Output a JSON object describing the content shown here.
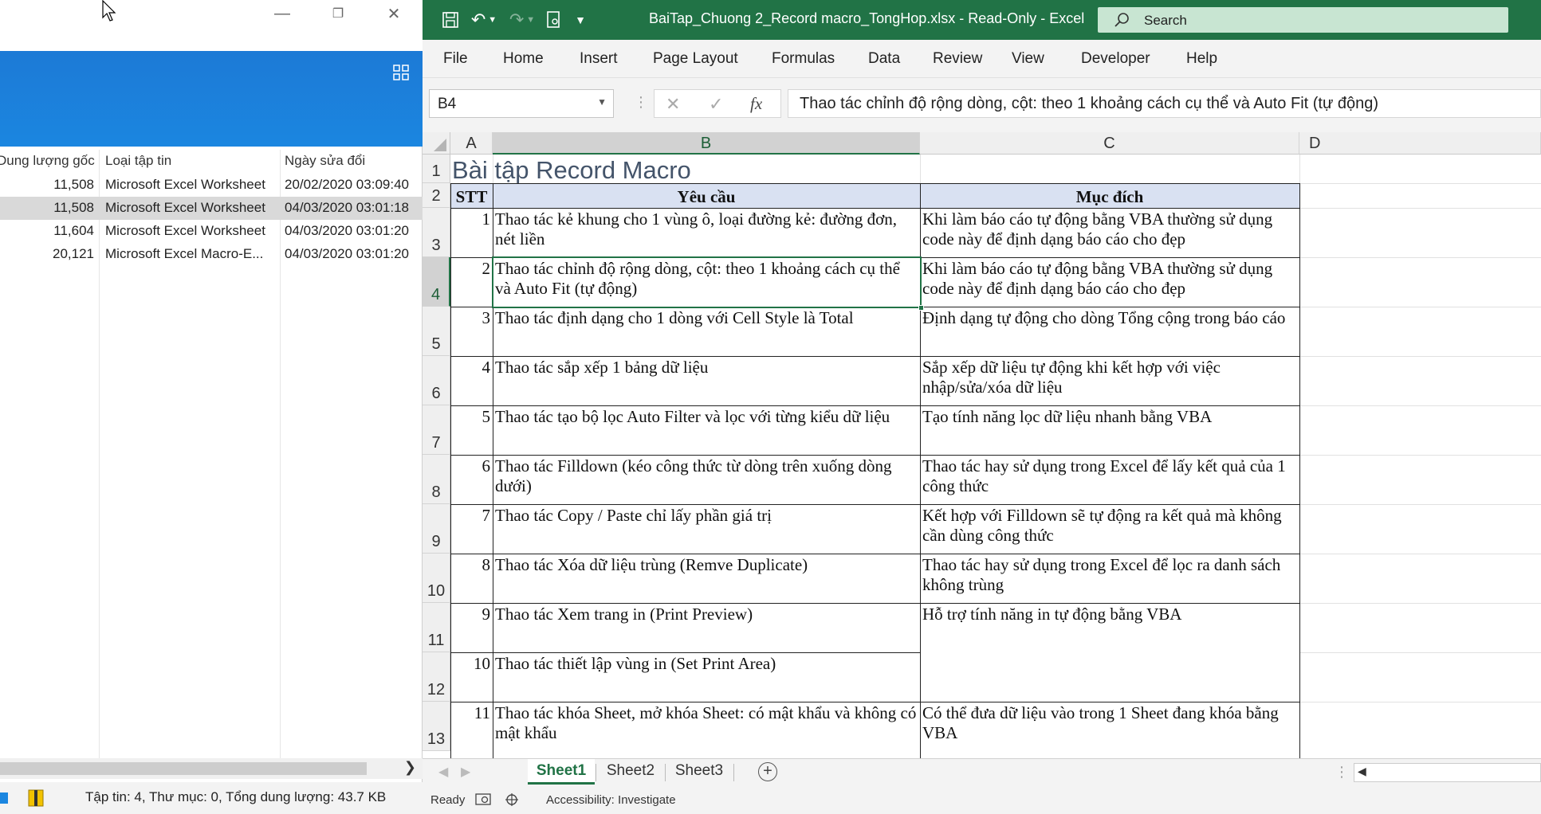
{
  "explorer": {
    "columns": {
      "size": "Dung lượng gốc",
      "type": "Loại tập tin",
      "modified": "Ngày sửa đổi"
    },
    "rows": [
      {
        "size": "11,508",
        "type": "Microsoft Excel Worksheet",
        "modified": "20/02/2020 03:09:40"
      },
      {
        "size": "11,508",
        "type": "Microsoft Excel Worksheet",
        "modified": "04/03/2020 03:01:18"
      },
      {
        "size": "11,604",
        "type": "Microsoft Excel Worksheet",
        "modified": "04/03/2020 03:01:20"
      },
      {
        "size": "20,121",
        "type": "Microsoft Excel Macro-E...",
        "modified": "04/03/2020 03:01:20"
      }
    ],
    "status": "Tập tin: 4, Thư mục: 0, Tổng dung lượng: 43.7 KB"
  },
  "excel": {
    "window_title": "BaiTap_Chuong 2_Record macro_TongHop.xlsx  -  Read-Only  -  Excel",
    "search_placeholder": "Search",
    "menu": [
      "File",
      "Home",
      "Insert",
      "Page Layout",
      "Formulas",
      "Data",
      "Review",
      "View",
      "Developer",
      "Help"
    ],
    "name_box": "B4",
    "formula_fx": "fx",
    "formula_value": "Thao tác chỉnh độ rộng dòng, cột: theo 1 khoảng cách cụ thể và Auto Fit (tự động)",
    "columns": [
      "A",
      "B",
      "C",
      "D"
    ],
    "rows": [
      "1",
      "2",
      "3",
      "4",
      "5",
      "6",
      "7",
      "8",
      "9",
      "10",
      "11",
      "12",
      "13"
    ],
    "sheet_title": "Bài tập Record Macro",
    "table_header": {
      "stt": "STT",
      "req": "Yêu cầu",
      "purpose": "Mục đích"
    },
    "table": [
      {
        "stt": "1",
        "req": "Thao tác kẻ khung cho 1 vùng ô, loại đường kẻ: đường đơn, nét liền",
        "purpose": "Khi làm báo cáo tự động bằng VBA thường sử dụng code này để định dạng báo cáo cho đẹp"
      },
      {
        "stt": "2",
        "req": "Thao tác chỉnh độ rộng dòng, cột: theo 1 khoảng cách cụ thể và Auto Fit (tự động)",
        "purpose": "Khi làm báo cáo tự động bằng VBA thường sử dụng code này để định dạng báo cáo cho đẹp"
      },
      {
        "stt": "3",
        "req": "Thao tác định dạng cho 1 dòng với Cell Style là Total",
        "purpose": "Định dạng tự động cho dòng Tổng cộng trong báo cáo"
      },
      {
        "stt": "4",
        "req": "Thao tác sắp xếp 1 bảng dữ liệu",
        "purpose": "Sắp xếp dữ liệu tự động khi kết hợp với việc nhập/sửa/xóa dữ liệu"
      },
      {
        "stt": "5",
        "req": "Thao tác tạo bộ lọc Auto Filter và lọc với từng kiểu dữ liệu",
        "purpose": "Tạo tính năng lọc dữ liệu nhanh bằng VBA"
      },
      {
        "stt": "6",
        "req": "Thao tác Filldown (kéo công thức từ dòng trên xuống dòng dưới)",
        "purpose": "Thao tác hay sử dụng trong Excel để lấy kết quả của 1 công thức"
      },
      {
        "stt": "7",
        "req": "Thao tác Copy / Paste chỉ lấy phần giá trị",
        "purpose": "Kết hợp với Filldown sẽ tự động ra kết quả mà không cần dùng công thức"
      },
      {
        "stt": "8",
        "req": "Thao tác Xóa dữ liệu trùng (Remve Duplicate)",
        "purpose": "Thao tác hay sử dụng trong Excel để lọc ra danh sách không trùng"
      },
      {
        "stt": "9",
        "req": "Thao tác Xem trang in (Print Preview)",
        "purpose": "Hỗ trợ tính năng in tự động bằng VBA"
      },
      {
        "stt": "10",
        "req": "Thao tác thiết lập vùng in (Set Print Area)",
        "purpose": ""
      },
      {
        "stt": "11",
        "req": "Thao tác khóa Sheet, mở khóa Sheet: có mật khẩu và không có mật khẩu",
        "purpose": "Có thể đưa dữ liệu vào trong 1 Sheet đang khóa bằng VBA"
      }
    ],
    "sheets": [
      "Sheet1",
      "Sheet2",
      "Sheet3"
    ],
    "status_ready": "Ready",
    "status_accessibility": "Accessibility: Investigate"
  },
  "colors": {
    "excel_green": "#217346",
    "header_fill": "#d9e1f2",
    "explorer_blue": "#1b86e0"
  }
}
